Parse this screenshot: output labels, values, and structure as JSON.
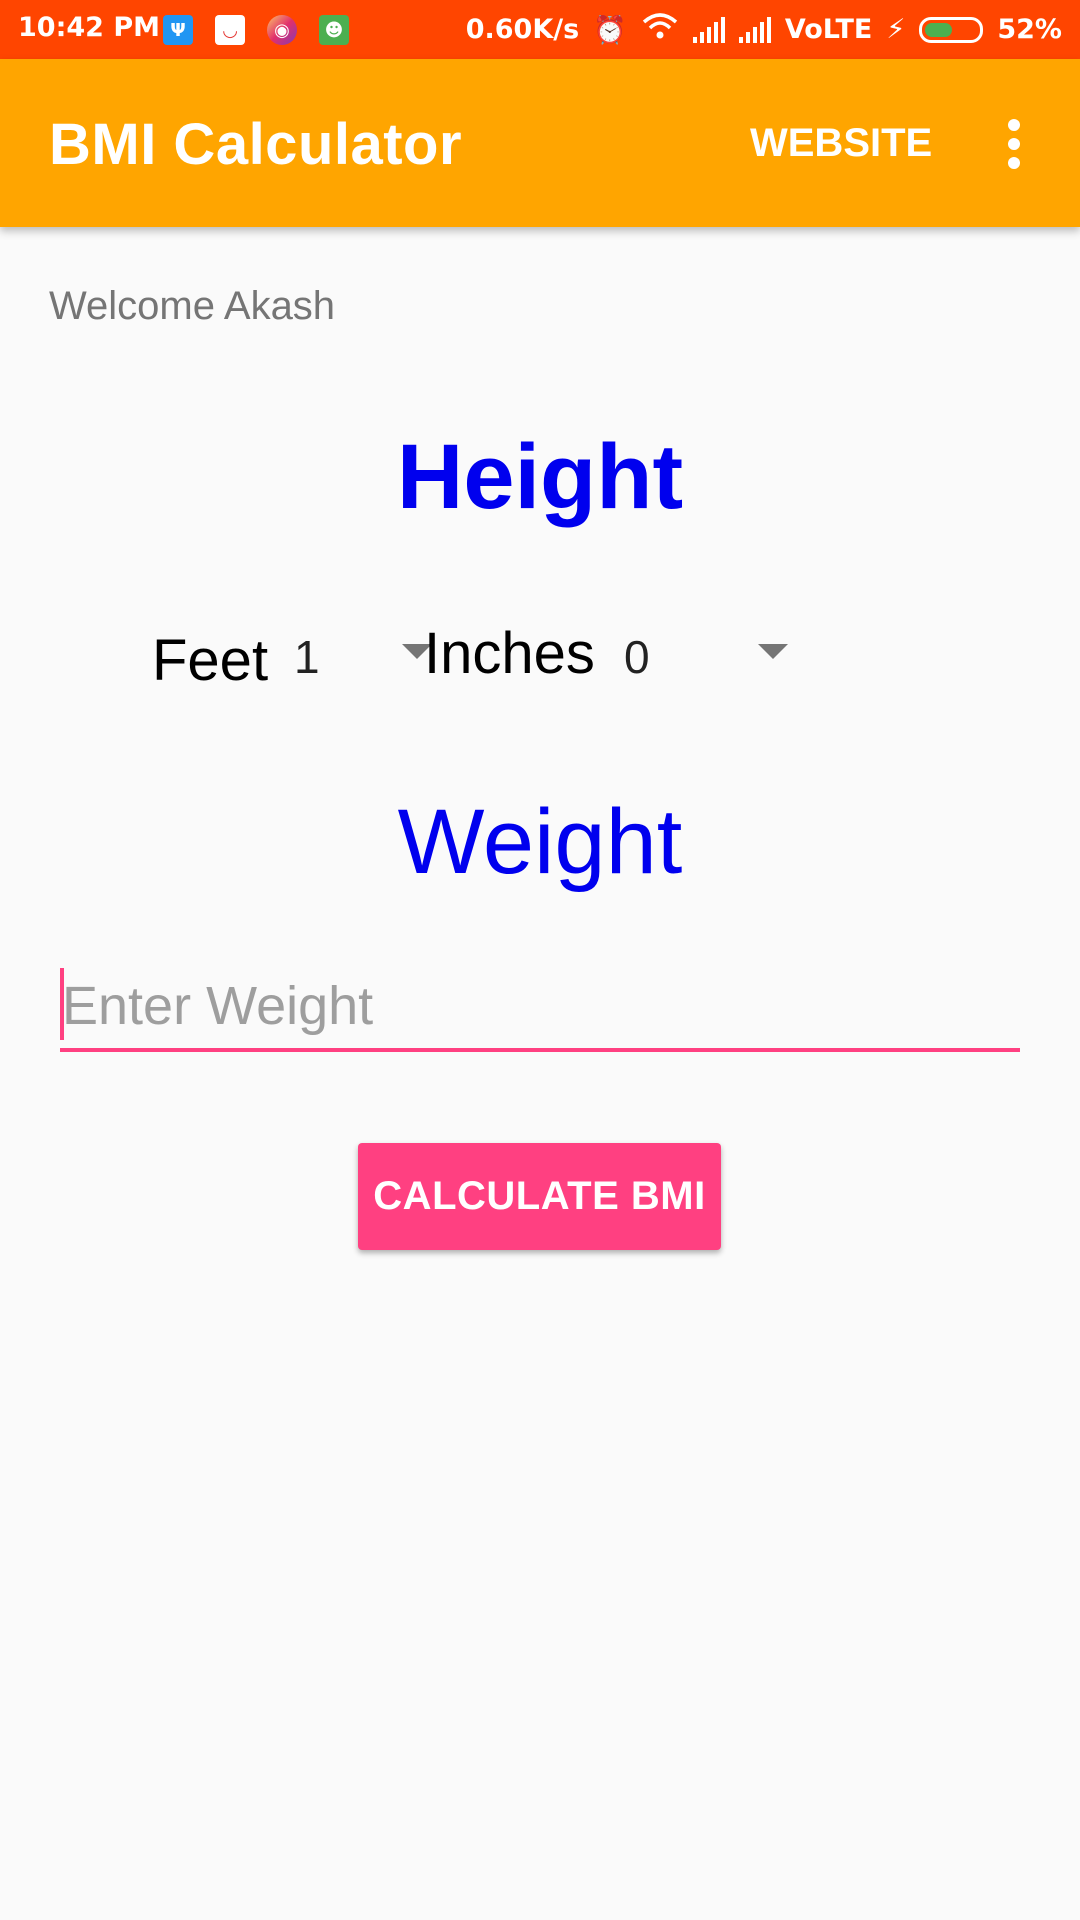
{
  "status_bar": {
    "time": "10:42 PM",
    "network_speed": "0.60K/s",
    "network_type": "VoLTE",
    "battery_percent": "52%",
    "battery_level": 0.52,
    "notification_icons": [
      "usb-icon",
      "shopping-icon",
      "instagram-icon",
      "android-icon"
    ],
    "status_icons": [
      "alarm-icon",
      "wifi-icon",
      "signal-icon",
      "charging-icon",
      "battery-icon"
    ]
  },
  "app_bar": {
    "title": "BMI Calculator",
    "website_action": "WEBSITE",
    "overflow_icon": "more-vert-icon",
    "background_color": "#ffa500"
  },
  "welcome_text": "Welcome Akash",
  "height_section": {
    "heading": "Height",
    "feet_label": "Feet",
    "feet_value": "1",
    "inches_label": "Inches",
    "inches_value": "0"
  },
  "weight_section": {
    "heading": "Weight",
    "input_placeholder": "Enter Weight",
    "input_value": ""
  },
  "calculate_button": {
    "label": "CALCULATE BMI",
    "color": "#ff4081"
  },
  "colors": {
    "status_bar": "#ff4500",
    "heading_blue": "#0000ee",
    "accent_pink": "#ff4081"
  }
}
